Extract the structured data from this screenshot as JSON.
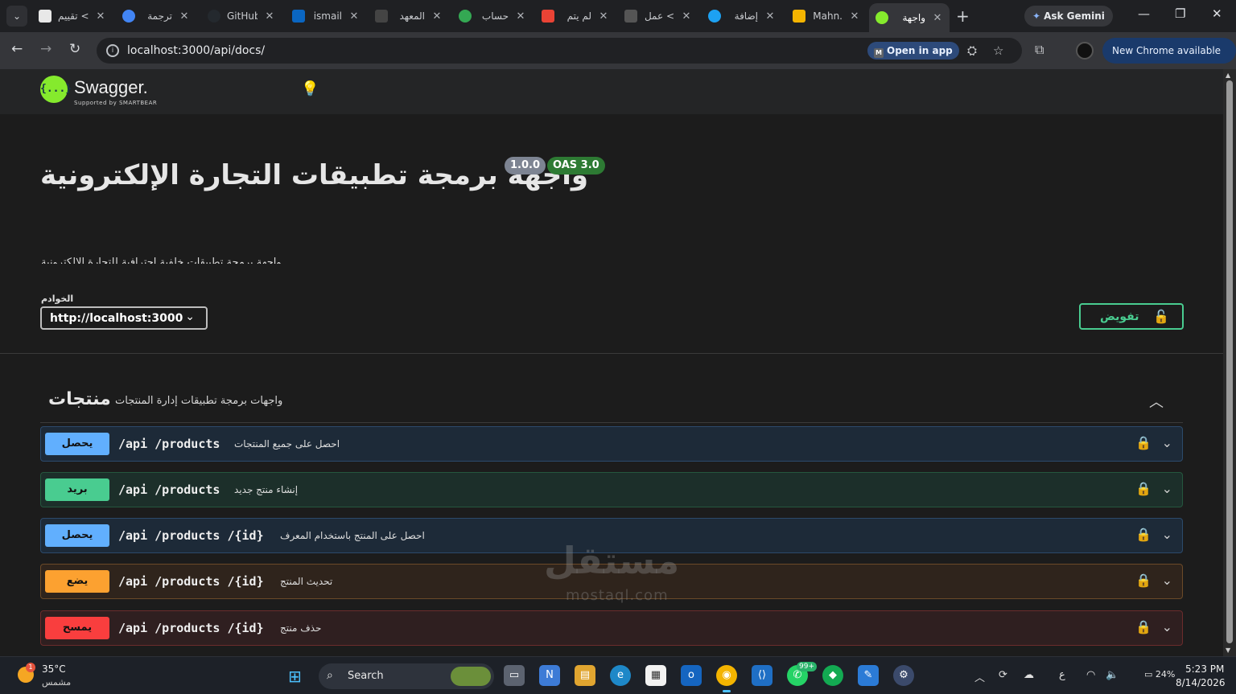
{
  "browser": {
    "tabs": [
      {
        "label": "تقييم <",
        "icon_color": "#e8e8e8"
      },
      {
        "label": "ترجمة",
        "icon_color": "#4285f4"
      },
      {
        "label": "GitHub",
        "icon_color": "#24292e"
      },
      {
        "label": "ismail",
        "icon_color": "#0a66c2"
      },
      {
        "label": "المعهد",
        "icon_color": "#444444"
      },
      {
        "label": "حساب",
        "icon_color": "#34a853"
      },
      {
        "label": "لم يتم",
        "icon_color": "#ea4335"
      },
      {
        "label": "عمل <",
        "icon_color": "#555555"
      },
      {
        "label": "إضافة",
        "icon_color": "#1da1f2"
      },
      {
        "label": "Mahn.",
        "icon_color": "#f4b400"
      },
      {
        "label": "واجهة",
        "icon_color": "#85ea2d"
      }
    ],
    "close_glyph": "✕",
    "new_tab_glyph": "+",
    "gemini_label": "Ask Gemini",
    "url": "localhost:3000/api/docs/",
    "open_in_app_label": "Open in app",
    "new_chrome_label": "New Chrome available",
    "glyphs": {
      "back": "←",
      "forward": "→",
      "reload": "↻",
      "star": "☆",
      "translate": "⛭",
      "extensions": "⧉",
      "menu": "⋮",
      "minimize": "—",
      "maximize": "❐",
      "close": "✕",
      "tabsearch": "⌄"
    }
  },
  "swagger": {
    "logo_glyph": "{...}",
    "name": "Swagger.",
    "supported_by": "Supported by SMARTBEAR",
    "title": "واجهة برمجة تطبيقات التجارة الإلكترونية",
    "version": "1.0.0",
    "oas": "OAS 3.0",
    "description": "واجهة برمجة تطبيقات خلفية احترافية للتجارة الإلكترونية",
    "servers_label": "الخوادم",
    "server_value": "http://localhost:3000",
    "authorize_label": "تفويض",
    "tag": {
      "name": "منتجات",
      "description": "واجهات برمجة تطبيقات إدارة المنتجات"
    },
    "operations": [
      {
        "method": "يحصل",
        "path": "/api /products",
        "summary": "احصل على جميع المنتجات"
      },
      {
        "method": "بريد",
        "path": "/api /products",
        "summary": "إنشاء منتج جديد"
      },
      {
        "method": "يحصل",
        "path": "/api /products /{id}",
        "summary": "احصل على المنتج باستخدام المعرف"
      },
      {
        "method": "يضع",
        "path": "/api /products /{id}",
        "summary": "تحديث المنتج"
      },
      {
        "method": "يمسح",
        "path": "/api /products /{id}",
        "summary": "حذف منتج"
      }
    ]
  },
  "watermark": {
    "arabic": "مستقل",
    "latin": "mostaql.com"
  },
  "taskbar": {
    "temperature": "35°C",
    "weather": "مشمس",
    "weather_badge": "1",
    "search_label": "Search",
    "whatsapp_badge": "99+",
    "lang": "ع",
    "battery": "24%",
    "time": "5:23 PM",
    "date": "8/14/2026"
  },
  "colors": {
    "get": "#61affe",
    "post": "#49cc90",
    "put": "#fca130",
    "delete": "#f93e3e",
    "swagger_green": "#85ea2d"
  }
}
